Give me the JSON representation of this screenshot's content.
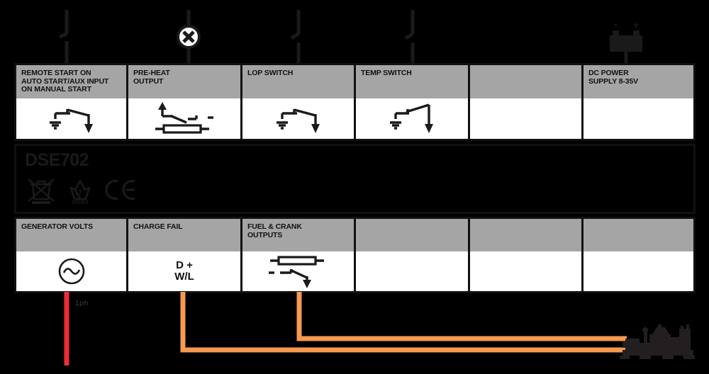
{
  "diagram": {
    "product": "DSE702",
    "compliance_marks": [
      {
        "name": "weee-crossed-bin-icon",
        "caption": ""
      },
      {
        "name": "recycling-other-icon",
        "caption": "OTHER",
        "resin_code": "7"
      },
      {
        "name": "ce-mark-icon",
        "caption": ""
      }
    ]
  },
  "top_connections": [
    {
      "name": "remote-start-switch-symbol",
      "type": "switch"
    },
    {
      "name": "pre-heat-lamp-symbol",
      "type": "lamp"
    },
    {
      "name": "lop-switch-symbol",
      "type": "switch"
    },
    {
      "name": "temp-switch-symbol",
      "type": "switch"
    },
    {
      "name": "battery-symbol",
      "type": "battery",
      "minus": "-",
      "plus": "+"
    }
  ],
  "terminal_rows": {
    "top": [
      {
        "label": "REMOTE START ON\nAUTO START/AUX INPUT\nON MANUAL START",
        "symbol": "ground-switch-output-icon"
      },
      {
        "label": "PRE-HEAT\nOUTPUT",
        "symbol": "relay-coil-contact-icon"
      },
      {
        "label": "LOP SWITCH",
        "symbol": "ground-switch-output-icon"
      },
      {
        "label": "TEMP SWITCH",
        "symbol": "ground-switch-output-icon"
      },
      {
        "label": "",
        "symbol": ""
      },
      {
        "label": "DC POWER\nSUPPLY 8-35V",
        "symbol": ""
      }
    ],
    "bottom": [
      {
        "label": "GENERATOR VOLTS",
        "symbol": "ac-source-icon"
      },
      {
        "label": "CHARGE FAIL",
        "symbol": "text",
        "text_line1": "D +",
        "text_line2": "W/L"
      },
      {
        "label": "FUEL & CRANK\nOUTPUTS",
        "symbol": "relay-contact-output-icon"
      },
      {
        "label": "",
        "symbol": ""
      },
      {
        "label": "",
        "symbol": ""
      },
      {
        "label": "",
        "symbol": ""
      }
    ]
  },
  "wires": [
    {
      "name": "generator-volts-wire",
      "label": "1ph",
      "color": "#ef2d38"
    },
    {
      "name": "charge-fail-wire",
      "label": "",
      "color": "#f59a4e"
    },
    {
      "name": "fuel-crank-wire",
      "label": "",
      "color": "#f59a4e"
    }
  ],
  "genset": {
    "name": "generator-set-illustration"
  },
  "colors": {
    "header_gray": "#a5a5a5",
    "cell_white": "#ffffff",
    "outline": "#111111",
    "red_wire": "#ef2d38",
    "orange_wire": "#f59a4e",
    "background": "#000000"
  }
}
